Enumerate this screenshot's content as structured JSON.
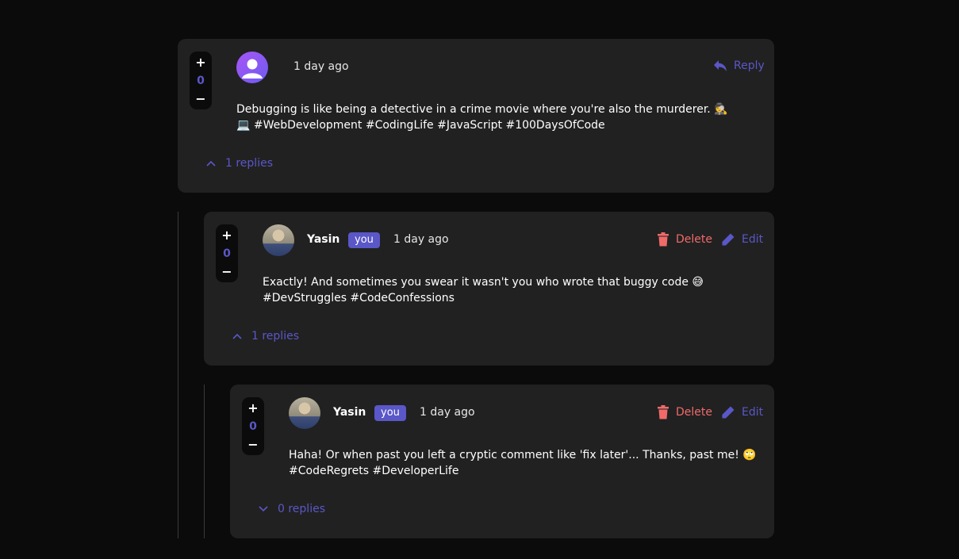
{
  "colors": {
    "accent": "#5a57c8",
    "danger": "#f06a6a",
    "card": "#212121",
    "background": "#0b0b0b"
  },
  "comments": [
    {
      "score": "0",
      "plus": "+",
      "minus": "−",
      "avatar": "default-user-avatar",
      "time": "1 day ago",
      "reply_label": "Reply",
      "text": "Debugging is like being a detective in a crime movie where you're also the murderer. 🕵️\n💻 #WebDevelopment #CodingLife #JavaScript #100DaysOfCode",
      "replies_label": "1 replies",
      "replies_expanded": true
    },
    {
      "score": "0",
      "plus": "+",
      "minus": "−",
      "avatar": "user-photo-avatar",
      "username": "Yasin",
      "badge": "you",
      "time": "1 day ago",
      "delete_label": "Delete",
      "edit_label": "Edit",
      "text": "Exactly! And sometimes you swear it wasn't you who wrote that buggy code 😅\n#DevStruggles #CodeConfessions",
      "replies_label": "1 replies",
      "replies_expanded": true
    },
    {
      "score": "0",
      "plus": "+",
      "minus": "−",
      "avatar": "user-photo-avatar",
      "username": "Yasin",
      "badge": "you",
      "time": "1 day ago",
      "delete_label": "Delete",
      "edit_label": "Edit",
      "text": "Haha! Or when past you left a cryptic comment like 'fix later'... Thanks, past me! 🙄\n#CodeRegrets #DeveloperLife",
      "replies_label": "0 replies",
      "replies_expanded": false
    }
  ]
}
